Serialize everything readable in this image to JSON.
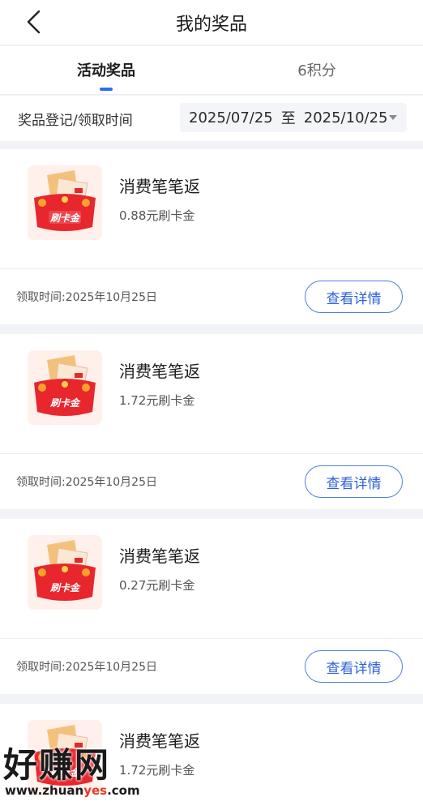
{
  "header": {
    "title": "我的奖品"
  },
  "tabs": [
    {
      "label": "活动奖品",
      "active": true
    },
    {
      "label": "6积分",
      "active": false
    }
  ],
  "filter": {
    "label": "奖品登记/领取时间",
    "start_date": "2025/07/25",
    "separator": "至",
    "end_date": "2025/10/25"
  },
  "prizes": [
    {
      "title": "消费笔笔返",
      "amount": "0.88元刷卡金",
      "time": "领取时间:2025年10月25日",
      "button": "查看详情",
      "badge": "刷卡金"
    },
    {
      "title": "消费笔笔返",
      "amount": "1.72元刷卡金",
      "time": "领取时间:2025年10月25日",
      "button": "查看详情",
      "badge": "刷卡金"
    },
    {
      "title": "消费笔笔返",
      "amount": "0.27元刷卡金",
      "time": "领取时间:2025年10月25日",
      "button": "查看详情",
      "badge": "刷卡金"
    },
    {
      "title": "消费笔笔返",
      "amount": "1.72元刷卡金",
      "time": "",
      "button": "",
      "badge": "刷卡金"
    }
  ],
  "watermark": {
    "brand": "好赚网",
    "url_prefix": "www.zhuan",
    "url_highlight": "yes",
    "url_suffix": ".com"
  },
  "colors": {
    "accent": "#2a6df4",
    "button_border": "#4f7ee6",
    "envelope": "#e8262e"
  },
  "icons": {
    "back": "chevron-left-icon",
    "dropdown": "caret-down-icon",
    "prize": "red-envelope-icon"
  }
}
